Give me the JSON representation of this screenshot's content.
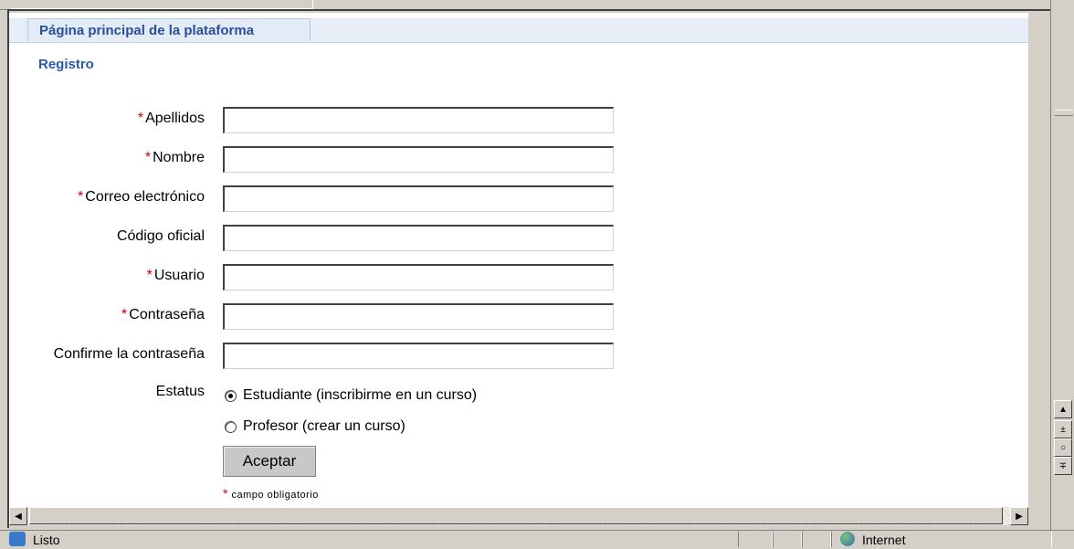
{
  "tabs": {
    "home_label": "Página principal de la plataforma"
  },
  "page": {
    "title": "Registro"
  },
  "form": {
    "fields": [
      {
        "label": "Apellidos",
        "required": true,
        "value": ""
      },
      {
        "label": "Nombre",
        "required": true,
        "value": ""
      },
      {
        "label": "Correo electrónico",
        "required": true,
        "value": ""
      },
      {
        "label": "Código oficial",
        "required": false,
        "value": ""
      },
      {
        "label": "Usuario",
        "required": true,
        "value": ""
      },
      {
        "label": "Contraseña",
        "required": true,
        "value": ""
      },
      {
        "label": "Confirme la contraseña",
        "required": false,
        "value": ""
      }
    ],
    "status_label": "Estatus",
    "status_options": [
      {
        "label": "Estudiante (inscribirme en un curso)",
        "selected": true
      },
      {
        "label": "Profesor (crear un curso)",
        "selected": false
      }
    ],
    "submit_label": "Aceptar",
    "required_marker": "*",
    "required_note": "campo obligatorio"
  },
  "statusbar": {
    "text": "Listo",
    "zone": "Internet"
  },
  "colors": {
    "required": "#d00000",
    "link": "#2a5aa8",
    "tab_bg": "#e3ebf7"
  },
  "icons": [
    "ie-page-icon",
    "globe-icon",
    "scroll-up-icon",
    "scroll-down-icon",
    "scroll-left-icon",
    "scroll-right-icon"
  ]
}
